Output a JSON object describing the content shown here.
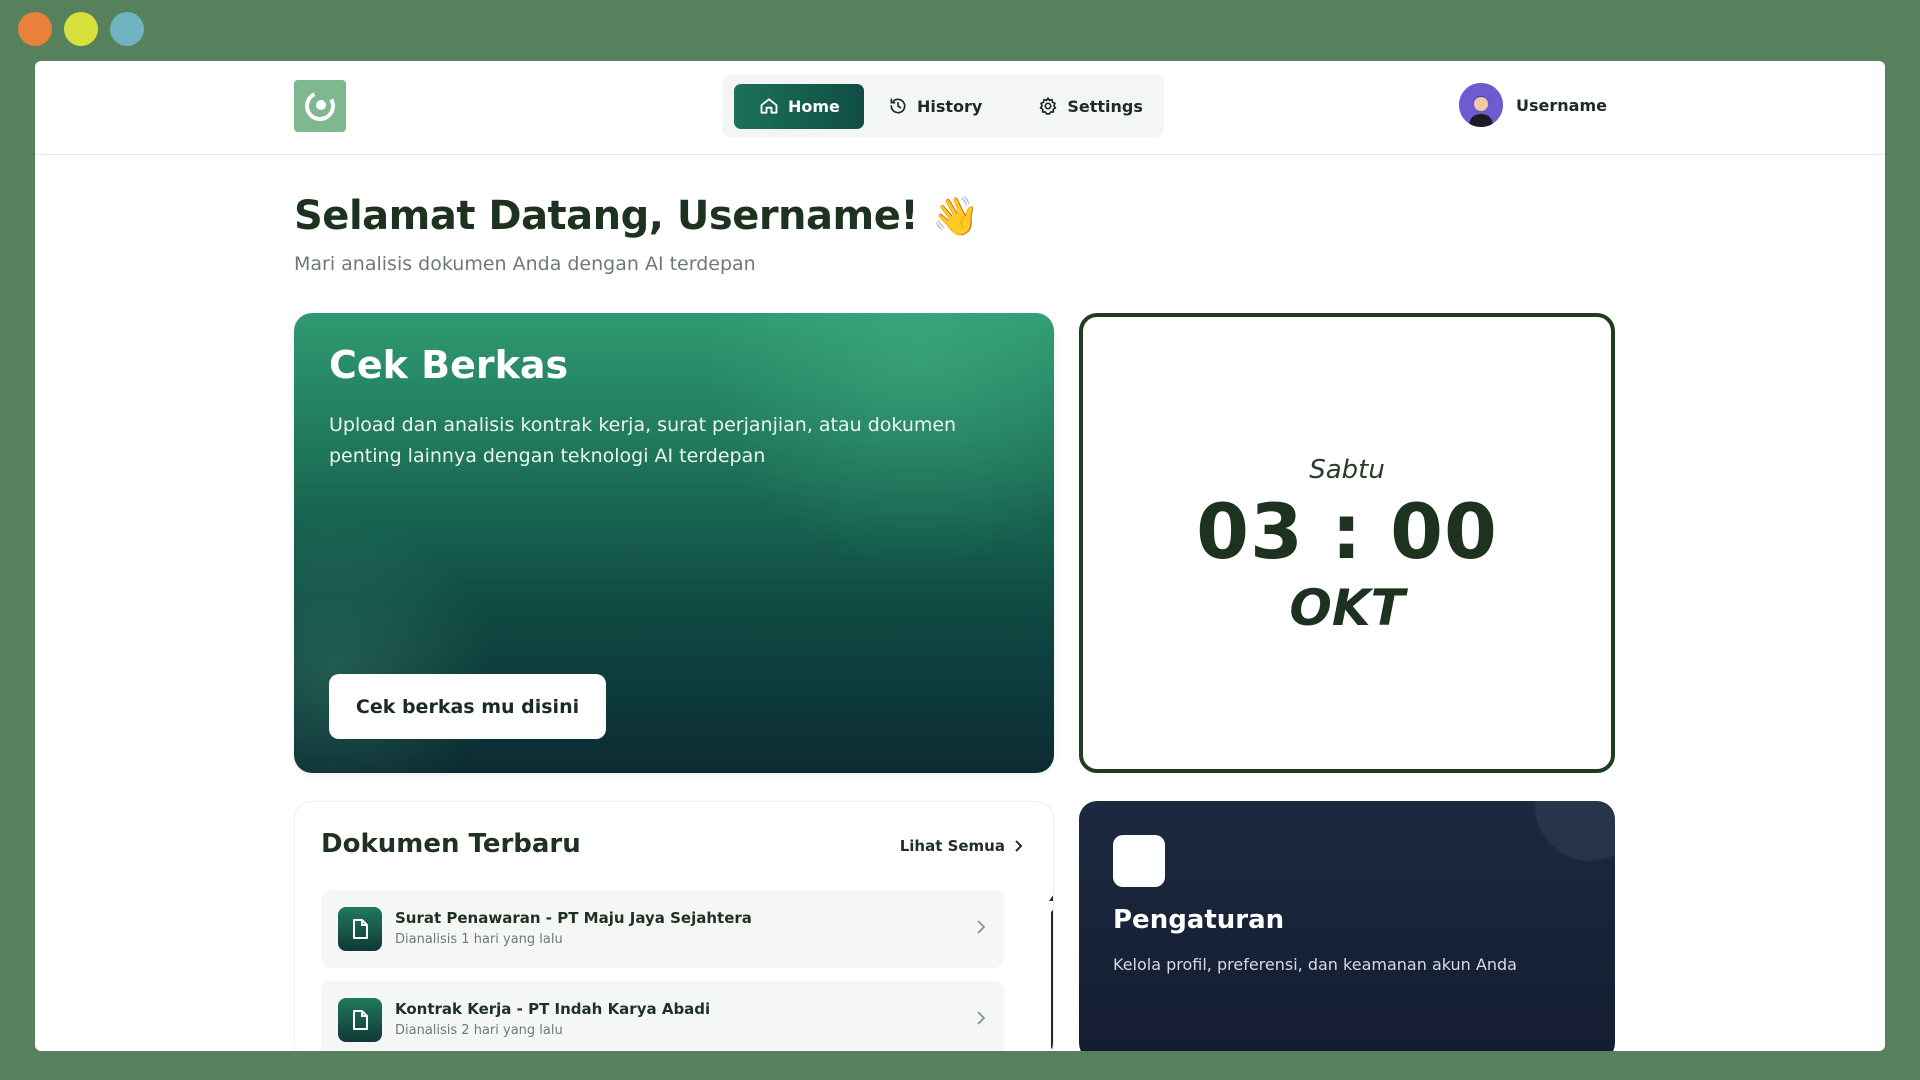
{
  "window_controls": [
    {
      "name": "close",
      "color": "#e8813a"
    },
    {
      "name": "minimize",
      "color": "#d8e03c"
    },
    {
      "name": "maximize",
      "color": "#6fb4c0"
    }
  ],
  "nav": {
    "home_label": "Home",
    "history_label": "History",
    "settings_label": "Settings",
    "username": "Username"
  },
  "welcome": {
    "title": "Selamat Datang, Username!",
    "emoji": "👋",
    "subtitle": "Mari analisis dokumen Anda dengan AI terdepan"
  },
  "cek_berkas": {
    "title": "Cek Berkas",
    "description": "Upload dan analisis kontrak kerja, surat perjanjian, atau dokumen penting lainnya dengan teknologi AI terdepan",
    "button_label": "Cek berkas mu disini"
  },
  "clock": {
    "day": "Sabtu",
    "time": "03 : 00",
    "month": "OKT"
  },
  "documents": {
    "title": "Dokumen Terbaru",
    "see_all": "Lihat Semua",
    "items": [
      {
        "title": "Surat Penawaran - PT Maju Jaya Sejahtera",
        "subtitle": "Dianalisis 1 hari yang lalu",
        "icon": "document-icon"
      },
      {
        "title": "Kontrak Kerja - PT Indah Karya Abadi",
        "subtitle": "Dianalisis 2 hari yang lalu",
        "icon": "document-icon"
      }
    ]
  },
  "settings_card": {
    "title": "Pengaturan",
    "description": "Kelola profil, preferensi, dan keamanan akun Anda"
  },
  "colors": {
    "background": "#57805d",
    "primary_green": "#1b7257",
    "dark_navy": "#1c2940",
    "text_dark": "#1d3320"
  }
}
